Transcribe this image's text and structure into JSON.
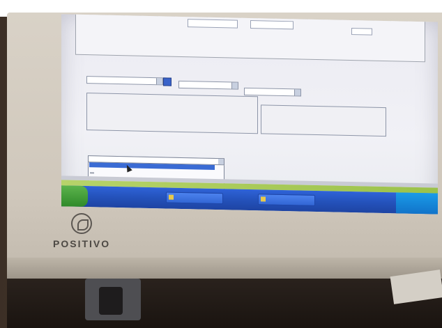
{
  "caption": "",
  "monitor": {
    "brand": "POSITIVO"
  },
  "screen": {
    "top_fields": {
      "labels": [
        "",
        ""
      ]
    },
    "section_title": "",
    "subsection_1": "",
    "subsection_2": "",
    "field_labels": [
      "",
      "",
      "",
      "",
      "",
      ""
    ],
    "dropdown": {
      "selected": "",
      "options_visible": 5
    }
  },
  "taskbar": {
    "buttons": [
      "",
      ""
    ],
    "clock": ""
  },
  "colors": {
    "screen_bg": "#eeeef4",
    "heading_blue": "#3d5a95",
    "taskbar_blue": "#2452bb",
    "start_green": "#3a9a32",
    "selection_blue": "#3a6bd4"
  }
}
